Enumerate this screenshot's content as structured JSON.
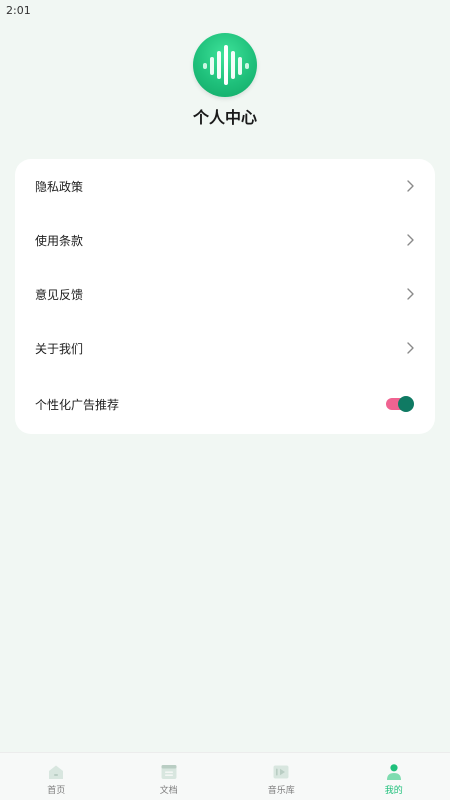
{
  "status_bar": {
    "time": "2:01"
  },
  "profile": {
    "title": "个人中心"
  },
  "menu": {
    "items": [
      {
        "label": "隐私政策"
      },
      {
        "label": "使用条款"
      },
      {
        "label": "意见反馈"
      },
      {
        "label": "关于我们"
      }
    ],
    "toggle_item": {
      "label": "个性化广告推荐",
      "enabled": true
    }
  },
  "nav": {
    "items": [
      {
        "label": "首页",
        "icon": "home-icon",
        "active": false
      },
      {
        "label": "文档",
        "icon": "document-icon",
        "active": false
      },
      {
        "label": "音乐库",
        "icon": "music-library-icon",
        "active": false
      },
      {
        "label": "我的",
        "icon": "profile-icon",
        "active": true
      }
    ]
  },
  "colors": {
    "background": "#f1f7f3",
    "accent": "#1fc07b",
    "toggle_track": "#f06391",
    "toggle_thumb": "#0f7a63"
  }
}
